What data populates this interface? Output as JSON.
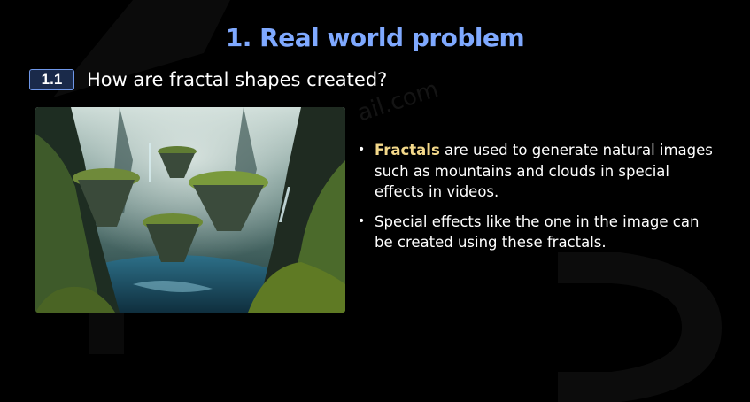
{
  "slide": {
    "title": "1. Real world problem",
    "section": {
      "number": "1.1",
      "heading": "How are fractal shapes created?"
    },
    "image": {
      "icon": "fantasy-floating-islands-landscape"
    },
    "bullets": [
      {
        "highlight": "Fractals",
        "text": " are used to generate natural images such as mountains and clouds in special effects in videos."
      },
      {
        "text": "Special effects like the one in the image can be created using these fractals."
      }
    ],
    "watermark": "ail.com"
  },
  "colors": {
    "background": "#000000",
    "title": "#7fa9ff",
    "badge_border": "#6f97e8",
    "highlight": "#f3d88a",
    "text": "#ffffff"
  }
}
